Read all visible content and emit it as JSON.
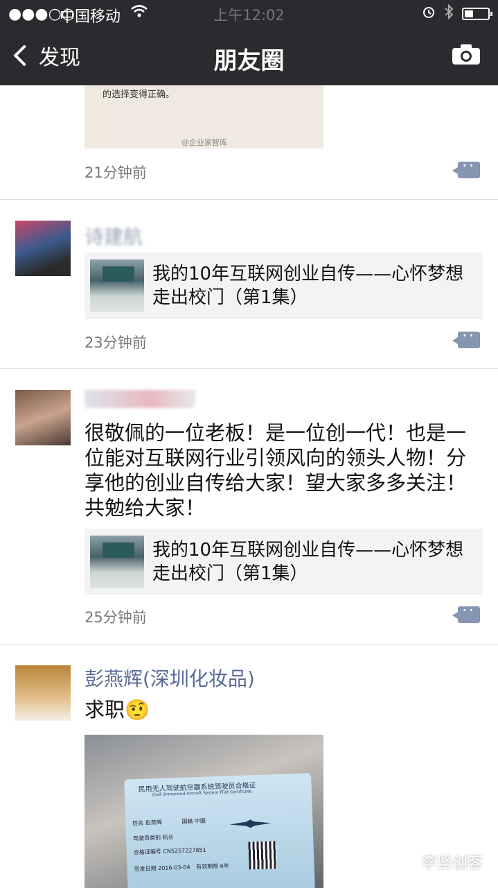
{
  "status_bar": {
    "signal": "●●●○○",
    "carrier": "中国移动",
    "time": "上午12:02"
  },
  "nav": {
    "back_label": "发现",
    "title": "朋友圈"
  },
  "posts": [
    {
      "image_caption": "的选择变得正确。",
      "image_credit": "@企业家智库",
      "time": "21分钟前"
    },
    {
      "name": "诗建航",
      "link_title": "我的10年互联网创业自传——心怀梦想走出校门（第1集）",
      "time": "23分钟前"
    },
    {
      "name": "",
      "text": "很敬佩的一位老板！是一位创一代！也是一位能对互联网行业引领风向的领头人物！分享他的创业自传给大家！望大家多多关注！共勉给大家！",
      "link_title": "我的10年互联网创业自传——心怀梦想走出校门（第1集）",
      "time": "25分钟前"
    },
    {
      "name": "彭燕辉(深圳化妆品)",
      "text": "求职",
      "emoji": "🤨",
      "card_title": "民用无人驾驶航空器系统驾驶员合格证",
      "card_subtitle": "Civil Unmanned Aircraft System Pilot Certificate",
      "card_name_label": "姓名",
      "card_name": "彭燕辉",
      "card_nation_label": "国籍",
      "card_nation": "中国",
      "card_type_label": "驾驶员类别",
      "card_type": "机长",
      "card_cert_label": "合格证编号",
      "card_cert": "CN52S7227851",
      "card_date_label": "签发日期",
      "card_date": "2016-03-04",
      "card_valid_label": "有效期限",
      "card_valid": "6年"
    }
  ],
  "watermark": "李坚创客",
  "colors": {
    "nav_bg": "#2b2b2f",
    "name_blue": "#576b95",
    "link_bg": "#f3f3f5"
  }
}
